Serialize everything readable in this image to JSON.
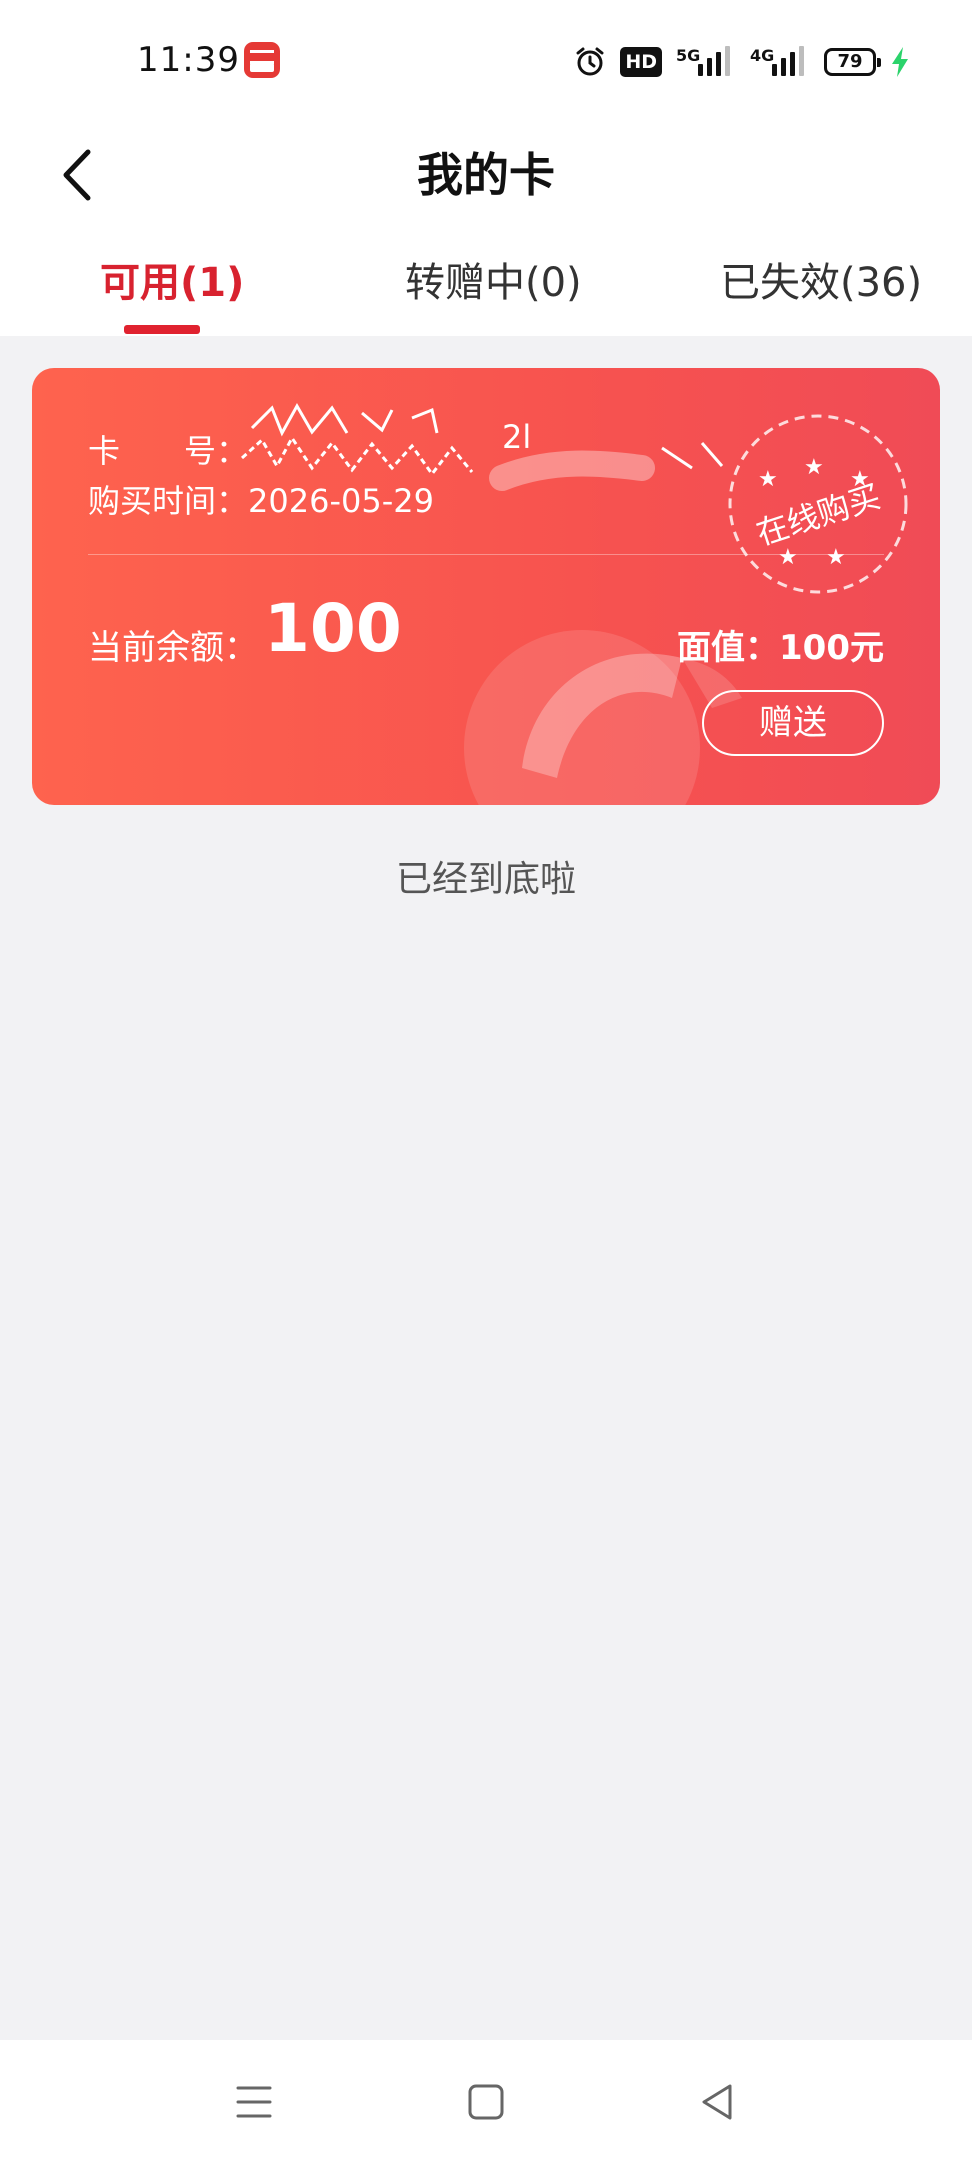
{
  "status_bar": {
    "time": "11:39",
    "hd_label": "HD",
    "net1_label": "5G",
    "net2_label": "4G",
    "battery": "79",
    "icons": [
      "app-icon",
      "alarm-icon",
      "hd-icon",
      "signal-5g-icon",
      "signal-4g-icon",
      "battery-icon",
      "charging-icon"
    ],
    "charge_color": "#2bd36b"
  },
  "header": {
    "title": "我的卡",
    "back_icon": "chevron-left-icon"
  },
  "tabs": [
    {
      "label": "可用(1)",
      "active": true
    },
    {
      "label": "转赠中(0)",
      "active": false
    },
    {
      "label": "已失效(36)",
      "active": false
    }
  ],
  "card": {
    "number_label": "卡　　号：",
    "number_value": "2l",
    "purchase_time_label": "购买时间：",
    "purchase_time_value": "2026-05-29",
    "stamp_text": "在线购买",
    "balance_label": "当前余额：",
    "balance_value": "100",
    "face_value_label": "面值：100元",
    "gift_button": "赠送",
    "brand_color": "#f7534f"
  },
  "list": {
    "end_text": "已经到底啦"
  },
  "system_nav": {
    "icons": [
      "menu-icon",
      "home-icon",
      "back-triangle-icon"
    ]
  }
}
